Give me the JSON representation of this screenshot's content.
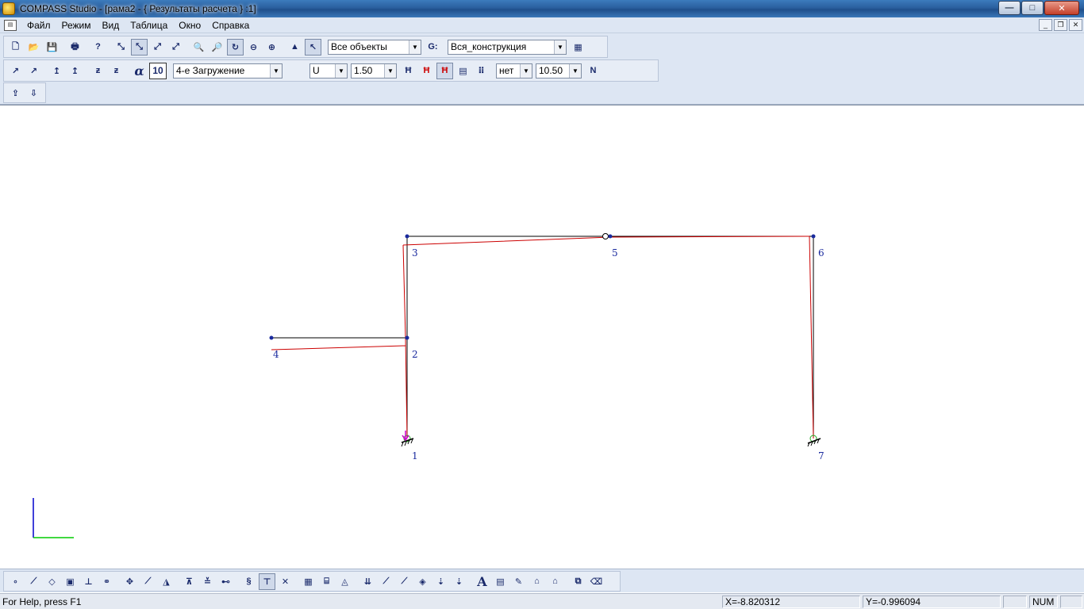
{
  "window": {
    "title": "COMPASS  Studio - [рама2 - { Результаты расчета } :1]",
    "buttons": {
      "minimize": "—",
      "maximize": "□",
      "close": "✕"
    }
  },
  "menu": {
    "items": [
      "Файл",
      "Режим",
      "Вид",
      "Таблица",
      "Окно",
      "Справка"
    ],
    "mdi": {
      "minimize": "_",
      "restore": "❐",
      "close": "✕"
    }
  },
  "toolbar1": {
    "objects_combo": "Все объекты",
    "construction_combo": "Вся_конструкция",
    "g_label": "G:"
  },
  "toolbar2": {
    "alpha_label": "α",
    "size_value": "10",
    "load_combo": "4-е Загружение",
    "result_combo": "U",
    "scale_combo": "1.50",
    "mode_combo": "нет",
    "value_combo": "10.50"
  },
  "nodes": [
    {
      "id": "1",
      "label": "1"
    },
    {
      "id": "2",
      "label": "2"
    },
    {
      "id": "3",
      "label": "3"
    },
    {
      "id": "4",
      "label": "4"
    },
    {
      "id": "5",
      "label": "5"
    },
    {
      "id": "6",
      "label": "6"
    },
    {
      "id": "7",
      "label": "7"
    }
  ],
  "colors": {
    "structure": "#000000",
    "deformed": "#cc0000",
    "node": "#1a2a9e",
    "axis_y": "#0000cc",
    "axis_x": "#00cc00",
    "load_arrow": "#cc00cc",
    "support_marker": "#22aa22"
  },
  "status": {
    "help": "For Help, press F1",
    "x": "X=-8.820312",
    "y": "Y=-0.996094",
    "num": "NUM"
  }
}
